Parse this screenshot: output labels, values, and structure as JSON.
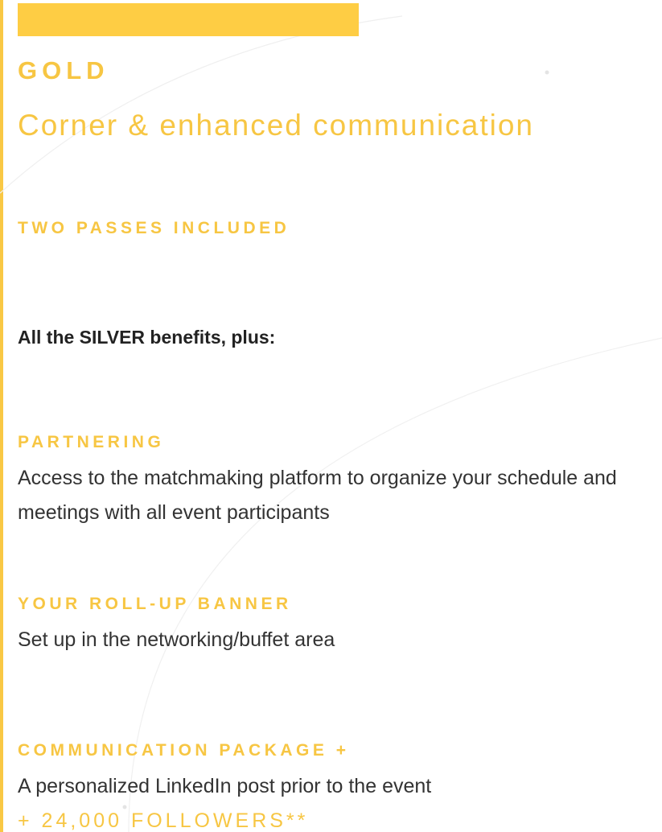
{
  "card": {
    "tier": "GOLD",
    "subtitle": "Corner & enhanced communication",
    "passes": "TWO PASSES INCLUDED",
    "intro": "All the SILVER benefits, plus:",
    "features": [
      {
        "title": "PARTNERING",
        "description": "Access to the matchmaking platform to organize your schedule and meetings with all event participants"
      },
      {
        "title": "YOUR ROLL-UP BANNER",
        "description": "Set up in the networking/buffet area"
      },
      {
        "title": "COMMUNICATION PACKAGE +",
        "description": "A personalized LinkedIn post prior to the event"
      }
    ],
    "followers": "+ 24,000 FOLLOWERS**"
  },
  "colors": {
    "accent": "#f7c643",
    "bar": "#fecd44",
    "body_text": "#333333",
    "decoration": "#f0f0f0"
  }
}
